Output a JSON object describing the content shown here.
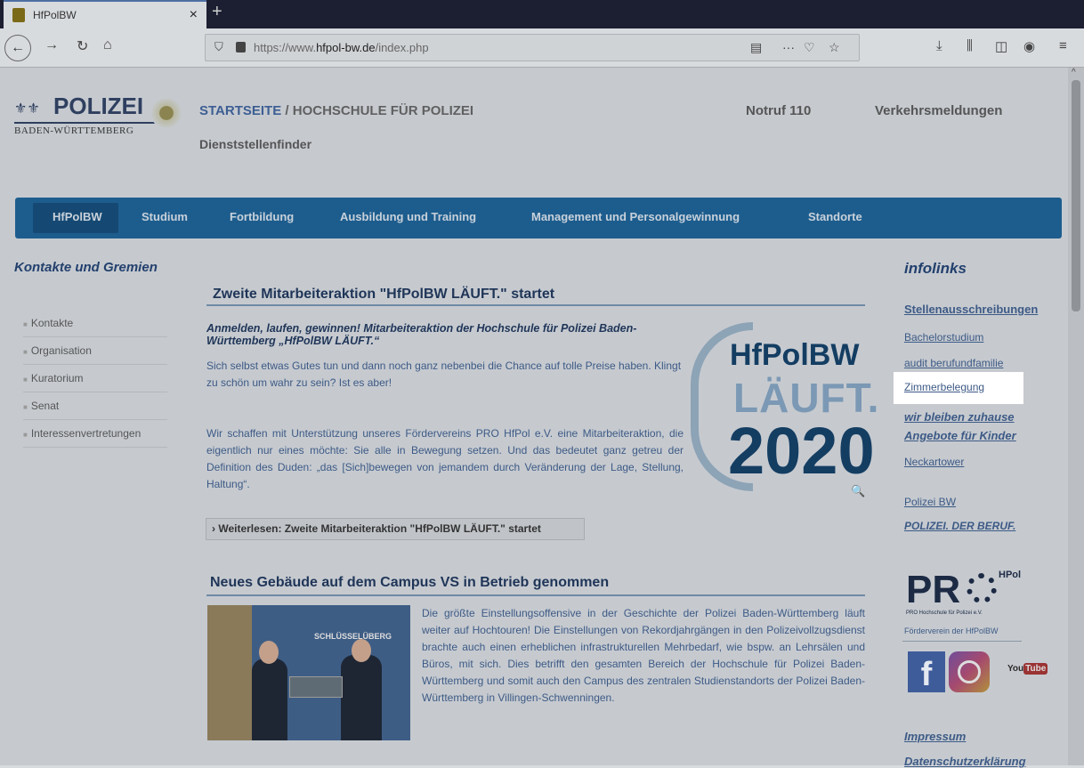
{
  "browser": {
    "tab_title": "HfPolBW",
    "tab_close": "×",
    "new_tab": "+",
    "url_prefix": "https://www.",
    "url_domain": "hfpol-bw.de",
    "url_path": "/index.php",
    "icons": [
      "back-icon",
      "forward-icon",
      "reload-icon",
      "home-icon",
      "shield-icon",
      "lock-icon",
      "reader-icon",
      "more-icon",
      "pocket-icon",
      "bookmark-star-icon",
      "download-icon",
      "library-icon",
      "sidebar-icon",
      "account-icon",
      "menu-icon"
    ]
  },
  "header": {
    "logo_word": "POLIZEI",
    "logo_sub": "BADEN-WÜRTTEMBERG",
    "breadcrumb_link": "STARTSEITE",
    "breadcrumb_sep": " / ",
    "breadcrumb_current": "HOCHSCHULE FÜR POLIZEI",
    "dienststellen": "Dienststellenfinder",
    "notruf": "Notruf 110",
    "verkehr": "Verkehrsmeldungen"
  },
  "menu": {
    "items": [
      "HfPolBW",
      "Studium",
      "Fortbildung",
      "Ausbildung und Training",
      "Management und Personalgewinnung",
      "Standorte"
    ]
  },
  "left": {
    "heading": "Kontakte und Gremien",
    "items": [
      "Kontakte",
      "Organisation",
      "Kuratorium",
      "Senat",
      "Interessenvertretungen"
    ]
  },
  "article1": {
    "title": "Zweite Mitarbeiteraktion \"HfPolBW LÄUFT.\" startet",
    "subtitle": "Anmelden, laufen, gewinnen! Mitarbeiteraktion der Hochschule für Polizei Baden-Württemberg „HfPolBW LÄUFT.“",
    "p1": "Sich selbst etwas Gutes tun und dann noch ganz nebenbei die Chance auf tolle Preise haben. Klingt zu schön um wahr zu sein? Ist es aber!",
    "p2": "Wir schaffen mit Unterstützung unseres Fördervereins PRO HfPol e.V. eine Mitarbeiteraktion, die eigentlich nur eines möchte: Sie alle in Bewegung setzen. Und das bedeutet ganz getreu der Definition des Duden: „das [Sich]bewegen von jemandem durch Veränderung der Lage, Stellung, Haltung“.",
    "more": "› Weiterlesen: Zweite Mitarbeiteraktion \"HfPolBW LÄUFT.\" startet",
    "badge_l1": "HfPolBW",
    "badge_l2": "LÄUFT.",
    "badge_l3": "2020"
  },
  "article2": {
    "title": "Neues Gebäude auf dem Campus VS in Betrieb genommen",
    "photo_sign": "SCHLÜSSELÜBERG",
    "text": "Die größte Einstellungsoffensive in der Geschichte der Polizei Baden-Württemberg läuft weiter auf Hochtouren! Die Einstellungen von Rekordjahrgängen in den Polizeivollzugsdienst brachte auch einen erheblichen infrastrukturellen Mehrbedarf, wie bspw. an Lehrsälen und Büros, mit sich. Dies betrifft den gesamten Bereich der Hochschule für Polizei Baden-Württemberg und somit auch den Campus des zentralen Studienstandorts der Polizei Baden-Württemberg in Villingen-Schwenningen."
  },
  "right": {
    "heading": "infolinks",
    "stellen": "Stellenausschreibungen",
    "bachelor": "Bachelorstudium",
    "audit": "audit berufundfamilie",
    "zimmer": "Zimmerbelegung",
    "zuhause": "wir bleiben zuhause",
    "angebote": "Angebote für Kinder",
    "neckar": "Neckartower",
    "polizeibw": "Polizei BW",
    "beruf": "POLIZEI. DER BERUF.",
    "pro_word": "PR",
    "pro_small": "PRO Hochschule für Polizei e.V.",
    "pro_side": "HPol",
    "foerder": "Förderverein der HfPolBW",
    "fb": "f",
    "yt_you": "You",
    "yt_tube": "Tube",
    "impressum": "Impressum",
    "datenschutz": "Datenschutzerklärung"
  }
}
